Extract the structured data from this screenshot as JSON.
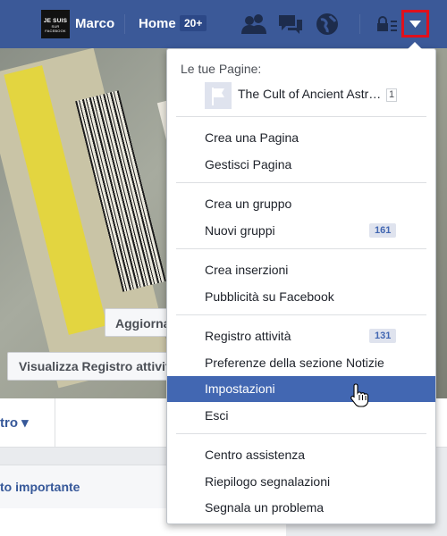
{
  "topbar": {
    "avatar_text_1": "JE SUIS",
    "avatar_text_2": "SUR FACEBOOK",
    "user_name": "Marco",
    "home_label": "Home",
    "home_badge": "20+"
  },
  "page": {
    "update_button": "Aggiorna informazioni",
    "activity_log_button": "Visualizza Registro attività",
    "tab_more": "tro ▾",
    "important_event": "to importante"
  },
  "menu": {
    "pages_heading": "Le tue Pagine:",
    "page_name": "The Cult of Ancient Astronauts",
    "page_count": "1",
    "sections": [
      [
        {
          "label": "Crea una Pagina"
        },
        {
          "label": "Gestisci Pagina"
        }
      ],
      [
        {
          "label": "Crea un gruppo"
        },
        {
          "label": "Nuovi gruppi",
          "badge": "161"
        }
      ],
      [
        {
          "label": "Crea inserzioni"
        },
        {
          "label": "Pubblicità su Facebook"
        }
      ],
      [
        {
          "label": "Registro attività",
          "badge": "131"
        },
        {
          "label": "Preferenze della sezione Notizie"
        },
        {
          "label": "Impostazioni",
          "selected": true
        },
        {
          "label": "Esci"
        }
      ],
      [
        {
          "label": "Centro assistenza"
        },
        {
          "label": "Riepilogo segnalazioni"
        },
        {
          "label": "Segnala un problema"
        }
      ]
    ]
  },
  "colors": {
    "brand_blue": "#3b5998",
    "highlight_blue": "#4267b2",
    "dropdown_outline_red": "#e0101c"
  }
}
